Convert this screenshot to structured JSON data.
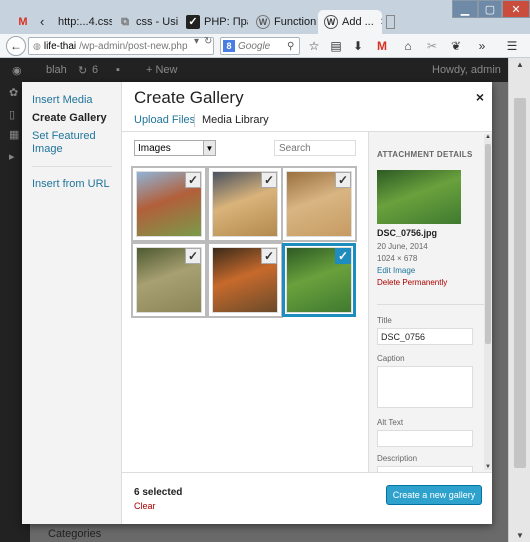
{
  "browser": {
    "tabs": [
      {
        "label": "http:...4.css",
        "icon": "gmail-icon"
      },
      {
        "label": "css - Usin...",
        "icon": "stackoverflow-icon"
      },
      {
        "label": "PHP: Пра...",
        "icon": "php-icon"
      },
      {
        "label": "Function ...",
        "icon": "wordpress-icon"
      },
      {
        "label": "Add ...",
        "icon": "wordpress-icon"
      }
    ],
    "url_host": "life-thai",
    "url_path": "/wp-admin/post-new.php",
    "search_placeholder": "Google",
    "search_engine_badge": "8"
  },
  "wp_admin_bar": {
    "site": "blah",
    "updates": "6",
    "new_label": "+ New",
    "howdy": "Howdy, admin"
  },
  "background": {
    "categories_label": "Categories"
  },
  "modal": {
    "menu": {
      "items": [
        "Insert Media",
        "Create Gallery",
        "Set Featured Image",
        "Insert from URL"
      ],
      "current_index": 1
    },
    "title": "Create Gallery",
    "close": "×",
    "router": {
      "upload": "Upload Files",
      "library": "Media Library"
    },
    "filter": {
      "selected": "Images"
    },
    "search_placeholder": "Search",
    "attachment_details": {
      "heading": "ATTACHMENT DETAILS",
      "filename": "DSC_0756.jpg",
      "date": "20 June, 2014",
      "dimensions": "1024 × 678",
      "edit_link": "Edit Image",
      "delete_link": "Delete Permanently",
      "title_label": "Title",
      "title_value": "DSC_0756",
      "caption_label": "Caption",
      "alt_label": "Alt Text",
      "description_label": "Description"
    },
    "selection": {
      "count_text": "6 selected",
      "clear": "Clear"
    },
    "create_button": "Create a new gallery",
    "thumbnails": [
      {
        "state": "selected",
        "colors": [
          "#7a9a4a",
          "#b25f3a",
          "#8fb3d6"
        ]
      },
      {
        "state": "selected",
        "colors": [
          "#b38a4e",
          "#d9b37a",
          "#4a5260"
        ]
      },
      {
        "state": "selected",
        "colors": [
          "#c69b62",
          "#d8b582",
          "#9a7040"
        ]
      },
      {
        "state": "selected",
        "colors": [
          "#8a8558",
          "#a7a072",
          "#4f5a30"
        ]
      },
      {
        "state": "selected",
        "colors": [
          "#6a4a2a",
          "#c76a2c",
          "#3a2a1a"
        ]
      },
      {
        "state": "active",
        "colors": [
          "#3f7a2f",
          "#6aa13d",
          "#2d5a24"
        ]
      }
    ]
  }
}
